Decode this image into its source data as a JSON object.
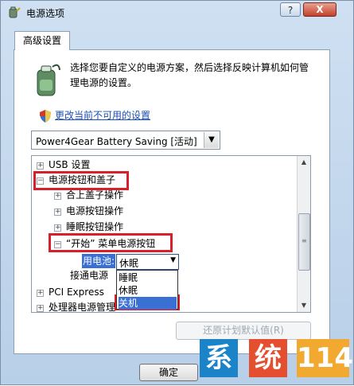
{
  "window": {
    "title": "电源选项",
    "help_label": "?",
    "close_label": "X"
  },
  "tab": {
    "label": "高级设置"
  },
  "description": "选择您要自定义的电源方案，然后选择反映计算机如何管理电源的设置。",
  "change_link": "更改当前不可用的设置",
  "plan_select": {
    "value": "Power4Gear Battery Saving [活动]"
  },
  "tree": {
    "items": [
      {
        "label": "USB 设置",
        "expander": "+"
      },
      {
        "label": "电源按钮和盖子",
        "expander": "−"
      },
      {
        "label": "合上盖子操作",
        "expander": "+"
      },
      {
        "label": "电源按钮操作",
        "expander": "+"
      },
      {
        "label": "睡眠按钮操作",
        "expander": "+"
      },
      {
        "label": "“开始” 菜单电源按钮",
        "expander": "−"
      },
      {
        "label": "用电池:"
      },
      {
        "label": "接通电源"
      },
      {
        "label": "PCI Express",
        "expander": "+"
      },
      {
        "label": "处理器电源管理",
        "expander": "+"
      }
    ],
    "inline_select": {
      "value": "休眠"
    },
    "dropdown_options": [
      "睡眠",
      "休眠",
      "关机"
    ]
  },
  "restore_button": "还原计划默认值(R)",
  "ok_button": "确定",
  "watermark": {
    "chars": [
      "系",
      "统",
      "114"
    ]
  },
  "colors": {
    "highlight": "#d7202a",
    "selection": "#3a6fd3",
    "link": "#1a4fb5"
  }
}
